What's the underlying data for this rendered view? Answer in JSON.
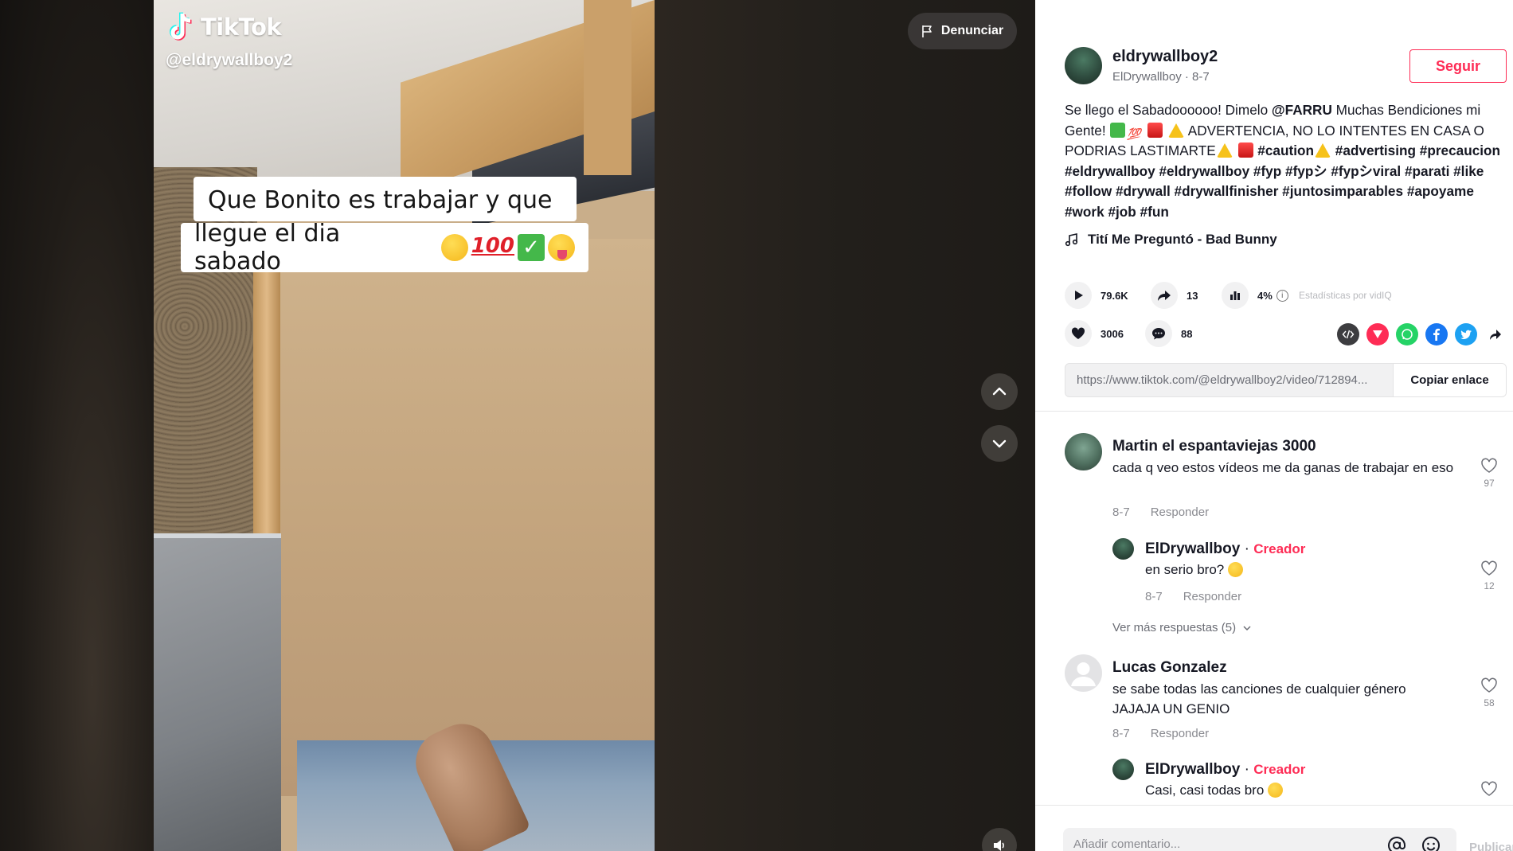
{
  "video": {
    "brand_name": "TikTok",
    "handle": "@eldrywallboy2",
    "caption_line_1": "Que Bonito es trabajar y que",
    "caption_line_2": "llegue el dia sabado",
    "caption_emoji": [
      "smirk",
      "100",
      "check",
      "tongue"
    ],
    "report_label": "Denunciar"
  },
  "author": {
    "username": "eldrywallboy2",
    "nickname": "ElDrywallboy",
    "date": "8-7",
    "follow_label": "Seguir"
  },
  "description": {
    "part_1": "Se llego el Sabadoooooo! Dimelo ",
    "mention": "@FARRU",
    "part_2": " Muchas Bendiciones mi Gente! ",
    "part_3": " ADVERTENCIA, NO LO INTENTES EN CASA O PODRIAS LASTIMARTE",
    "part_4": " #caution",
    "hashtags": "#advertising #precaucion #eldrywallboy #eldrywallboy #fyp #fypシ #fypシviral #parati #like #follow #drywall #drywallfinisher #juntosimparables #apoyame #work #job #fun"
  },
  "music": {
    "title": "Tití Me Preguntó - Bad Bunny"
  },
  "stats": {
    "plays": "79.6K",
    "shares": "13",
    "engagement": "4%",
    "vidiq_label": "Estadísticas por vidIQ",
    "likes": "3006",
    "comments": "88"
  },
  "share": {
    "link": "https://www.tiktok.com/@eldrywallboy2/video/712894...",
    "copy_label": "Copiar enlace"
  },
  "comments": [
    {
      "name": "Martin el espantaviejas 3000",
      "text": "cada q veo estos vídeos me da ganas de trabajar en eso",
      "date": "8-7",
      "reply_label": "Responder",
      "likes": "97"
    },
    {
      "name": "ElDrywallboy",
      "badge": "Creador",
      "text": "en serio bro?",
      "date": "8-7",
      "reply_label": "Responder",
      "likes": "12"
    },
    {
      "name": "Lucas Gonzalez",
      "text": "se sabe todas las canciones de cualquier género JAJAJA UN GENIO",
      "date": "8-7",
      "reply_label": "Responder",
      "likes": "58"
    },
    {
      "name": "ElDrywallboy",
      "badge": "Creador",
      "text": "Casi, casi todas bro",
      "likes": ""
    }
  ],
  "more_replies_label": "Ver más respuestas (5)",
  "comment_bar": {
    "placeholder": "Añadir comentario...",
    "post_label": "Publicar"
  },
  "colors": {
    "accent": "#fe2c55",
    "creator": "#fe2c55",
    "whatsapp": "#25d366",
    "facebook": "#1877f2",
    "twitter": "#1da1f2"
  }
}
